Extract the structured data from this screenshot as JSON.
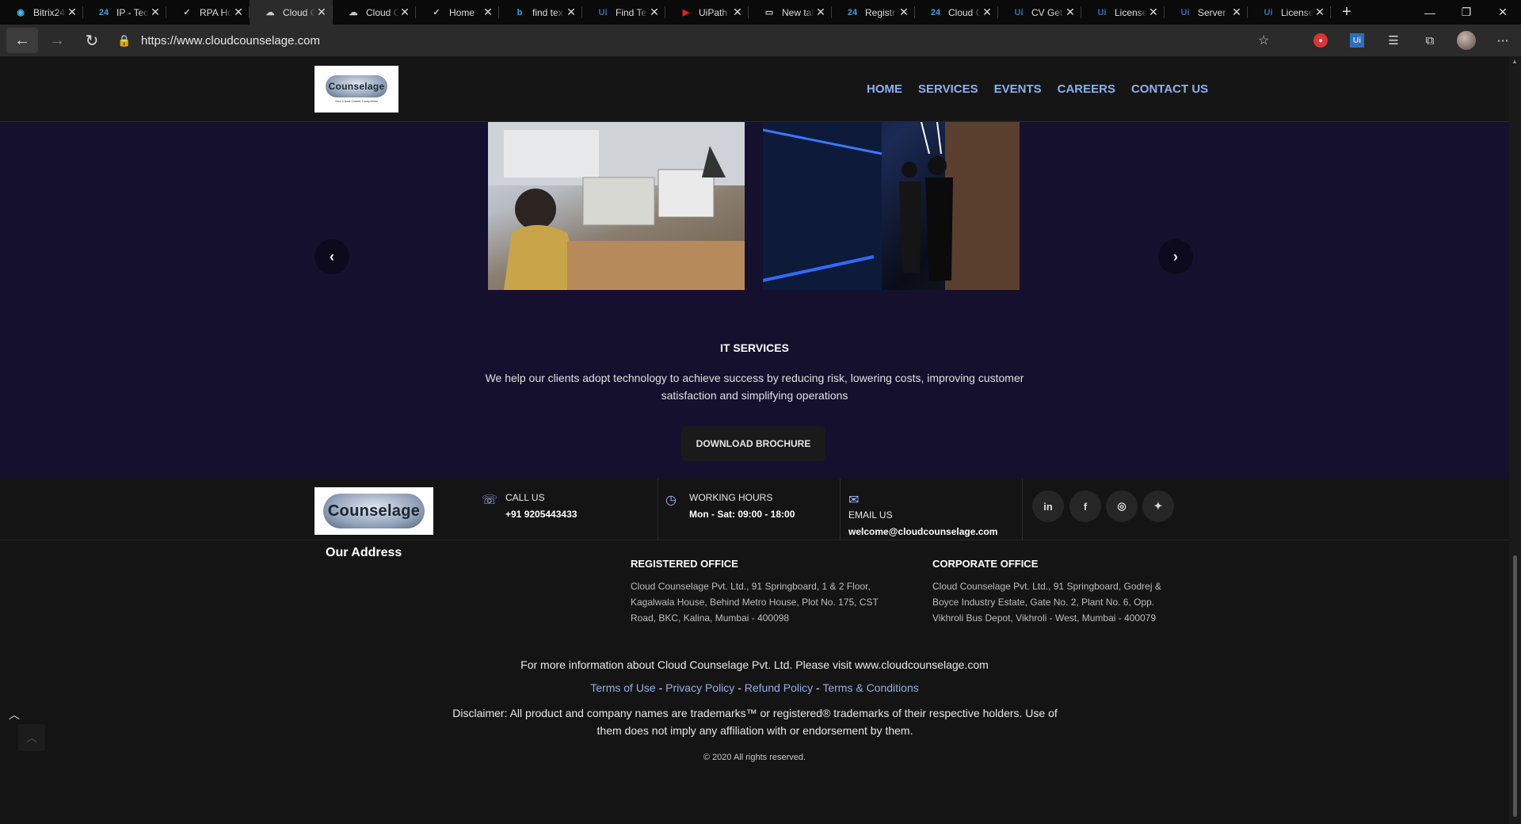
{
  "browser": {
    "tabs": [
      {
        "label": "Bitrix24",
        "icon": "camera-icon",
        "icon_color": "#2fc6f6"
      },
      {
        "label": "IP - Tec",
        "icon": "bitrix-24-icon",
        "icon_color": "#3aa0e0"
      },
      {
        "label": "RPA Ho",
        "icon": "check-icon",
        "icon_color": "#cccccc"
      },
      {
        "label": "Cloud C",
        "icon": "cloud-icon",
        "icon_color": "#cccccc"
      },
      {
        "label": "Cloud C",
        "icon": "cloud-icon",
        "icon_color": "#cccccc"
      },
      {
        "label": "Home",
        "icon": "check-icon",
        "icon_color": "#cccccc"
      },
      {
        "label": "find tex",
        "icon": "bing-icon",
        "icon_color": "#2aa5e0"
      },
      {
        "label": "Find Te",
        "icon": "uipath-icon",
        "icon_color": "#2a6fbf"
      },
      {
        "label": "UiPath",
        "icon": "youtube-icon",
        "icon_color": "#e02020"
      },
      {
        "label": "New tal",
        "icon": "newtab-icon",
        "icon_color": "#cccccc"
      },
      {
        "label": "Registr",
        "icon": "bitrix-24-icon",
        "icon_color": "#3aa0e0"
      },
      {
        "label": "Cloud C",
        "icon": "bitrix-24-icon",
        "icon_color": "#3aa0e0"
      },
      {
        "label": "CV Get",
        "icon": "uipath-icon",
        "icon_color": "#2a6fbf"
      },
      {
        "label": "License",
        "icon": "uipath-icon",
        "icon_color": "#2a6fbf"
      },
      {
        "label": "Server",
        "icon": "uipath-icon",
        "icon_color": "#2a6fbf"
      },
      {
        "label": "License",
        "icon": "uipath-icon",
        "icon_color": "#2a6fbf"
      }
    ],
    "url": "https://www.cloudcounselage.com"
  },
  "site": {
    "logo_text": "Counselage",
    "logo_tagline": "Your Cloud Career Companion",
    "nav": [
      "HOME",
      "SERVICES",
      "EVENTS",
      "CAREERS",
      "CONTACT US"
    ],
    "services": {
      "title": "IT SERVICES",
      "description": "We help our clients adopt technology to achieve success by reducing risk, lowering costs, improving customer satisfaction and simplifying operations",
      "button": "DOWNLOAD BROCHURE"
    },
    "contact": {
      "call_label": "CALL US",
      "call_value": "+91 9205443433",
      "hours_label": "WORKING HOURS",
      "hours_value": "Mon - Sat: 09:00 - 18:00",
      "email_label": "EMAIL US",
      "email_value": "welcome@cloudcounselage.com"
    },
    "social": [
      "in",
      "f",
      "◎",
      "✦"
    ],
    "address": {
      "title": "Our Address",
      "registered_title": "REGISTERED OFFICE",
      "registered_text": "Cloud Counselage Pvt. Ltd., 91 Springboard, 1 & 2 Floor, Kagalwala House, Behind Metro House, Plot No. 175, CST Road, BKC, Kalina, Mumbai - 400098",
      "corporate_title": "CORPORATE OFFICE",
      "corporate_text": "Cloud Counselage Pvt. Ltd., 91 Springboard, Godrej & Boyce Industry Estate, Gate No. 2, Plant No. 6, Opp. Vikhroli Bus Depot, Vikhroli - West, Mumbai - 400079"
    },
    "more_info": "For more information about Cloud Counselage Pvt. Ltd. Please visit www.cloudcounselage.com",
    "policy": {
      "terms_of_use": "Terms of Use",
      "privacy": "Privacy Policy",
      "refund": "Refund Policy",
      "conditions": "Terms & Conditions",
      "sep": " - "
    },
    "disclaimer": "Disclaimer: All product and company names are trademarks™ or registered® trademarks of their respective holders. Use of them does not imply any affiliation with or endorsement by them.",
    "copyright": "© 2020 All rights reserved."
  }
}
